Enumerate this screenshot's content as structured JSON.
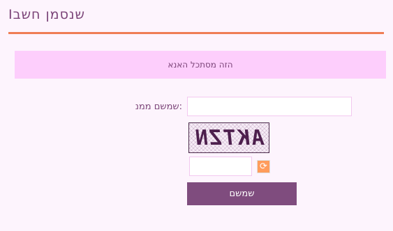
{
  "header": {
    "title": "Iשנסמן חשב"
  },
  "notice": {
    "text": "הזה מסתכל האנא"
  },
  "form": {
    "name_label": "שמשם ממנ:",
    "name_value": "",
    "captcha_text": "AKTZN",
    "captcha_value": "",
    "refresh_icon": "refresh-icon",
    "submit_label": "שמשם"
  },
  "colors": {
    "accent_rule": "#ef7d55",
    "notice_bg": "#fdcefc",
    "button_bg": "#7f4c7e",
    "refresh_bg": "#ff9c5c"
  }
}
